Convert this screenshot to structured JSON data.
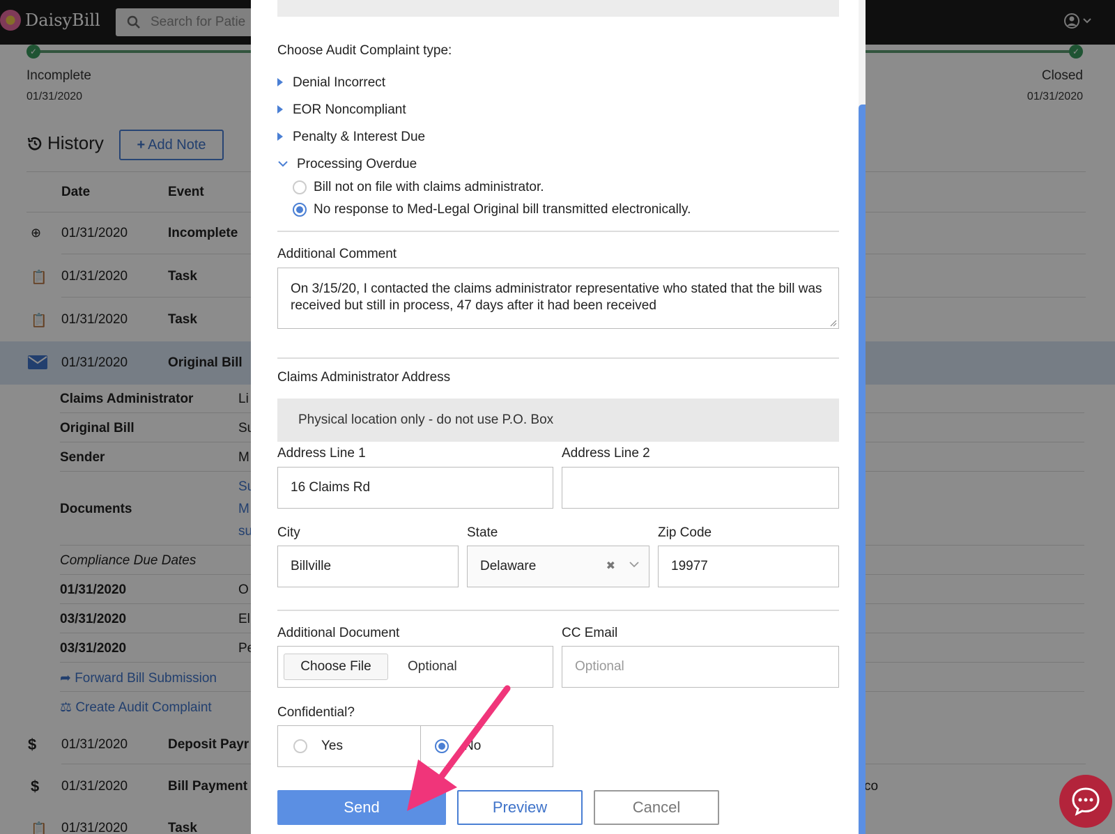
{
  "app": {
    "name": "DaisyBill"
  },
  "search": {
    "placeholder": "Search for Patie"
  },
  "progress": {
    "left": {
      "label": "Incomplete",
      "date": "01/31/2020"
    },
    "right": {
      "label": "Closed",
      "date": "01/31/2020"
    }
  },
  "history": {
    "title": "History",
    "add_note": "Add Note",
    "columns": {
      "date": "Date",
      "event": "Event"
    },
    "rows": [
      {
        "date": "01/31/2020",
        "event": "Incomplete"
      },
      {
        "date": "01/31/2020",
        "event": "Task"
      },
      {
        "date": "01/31/2020",
        "event": "Task"
      },
      {
        "date": "01/31/2020",
        "event": "Original Bill"
      }
    ],
    "details": {
      "claims_admin": "Claims Administrator",
      "claims_admin_val": "Li",
      "original_bill": "Original Bill",
      "original_bill_val": "Su",
      "sender": "Sender",
      "sender_val": "M",
      "documents": "Documents",
      "doc_1": "Su",
      "doc_2": "M",
      "doc_3": "su",
      "compliance": "Compliance Due Dates",
      "due": [
        {
          "date": "01/31/2020",
          "val": "O"
        },
        {
          "date": "03/31/2020",
          "val": "El"
        },
        {
          "date": "03/31/2020",
          "val": "Pe"
        }
      ],
      "forward": "Forward Bill Submission",
      "create_audit": "Create Audit Complaint"
    },
    "lower_rows": [
      {
        "date": "01/31/2020",
        "event": "Deposit Payr"
      },
      {
        "date": "01/31/2020",
        "event": "Bill Payment",
        "extra": "co"
      },
      {
        "date": "01/31/2020",
        "event": "Task"
      }
    ]
  },
  "modal": {
    "complaint_type_title": "Choose Audit Complaint type:",
    "types": [
      {
        "label": "Denial Incorrect"
      },
      {
        "label": "EOR Noncompliant"
      },
      {
        "label": "Penalty & Interest Due"
      }
    ],
    "expanded_type": "Processing Overdue",
    "options": [
      {
        "label": "Bill not on file with claims administrator.",
        "selected": false
      },
      {
        "label": "No response to Med-Legal Original bill transmitted electronically.",
        "selected": true
      }
    ],
    "comment_label": "Additional Comment",
    "comment_value": "On 3/15/20, I contacted the claims administrator representative who stated that the bill was received but still in process, 47 days after it had been received",
    "address_title": "Claims Administrator Address",
    "address_notice": "Physical location only - do not use P.O. Box",
    "address1_label": "Address Line 1",
    "address1_value": "16 Claims Rd",
    "address2_label": "Address Line 2",
    "address2_value": "",
    "city_label": "City",
    "city_value": "Billville",
    "state_label": "State",
    "state_value": "Delaware",
    "zip_label": "Zip Code",
    "zip_value": "19977",
    "document_label": "Additional Document",
    "choose_file": "Choose File",
    "file_status": "Optional",
    "cc_label": "CC Email",
    "cc_placeholder": "Optional",
    "confidential_label": "Confidential?",
    "confidential_yes": "Yes",
    "confidential_no": "No",
    "confidential_selected": "No",
    "send": "Send",
    "preview": "Preview",
    "cancel": "Cancel"
  },
  "colors": {
    "accent": "#5b8fe3",
    "link": "#3f73c9",
    "success": "#3a9a5e",
    "annotation_arrow": "#f0357a",
    "chat": "#b3243b"
  }
}
